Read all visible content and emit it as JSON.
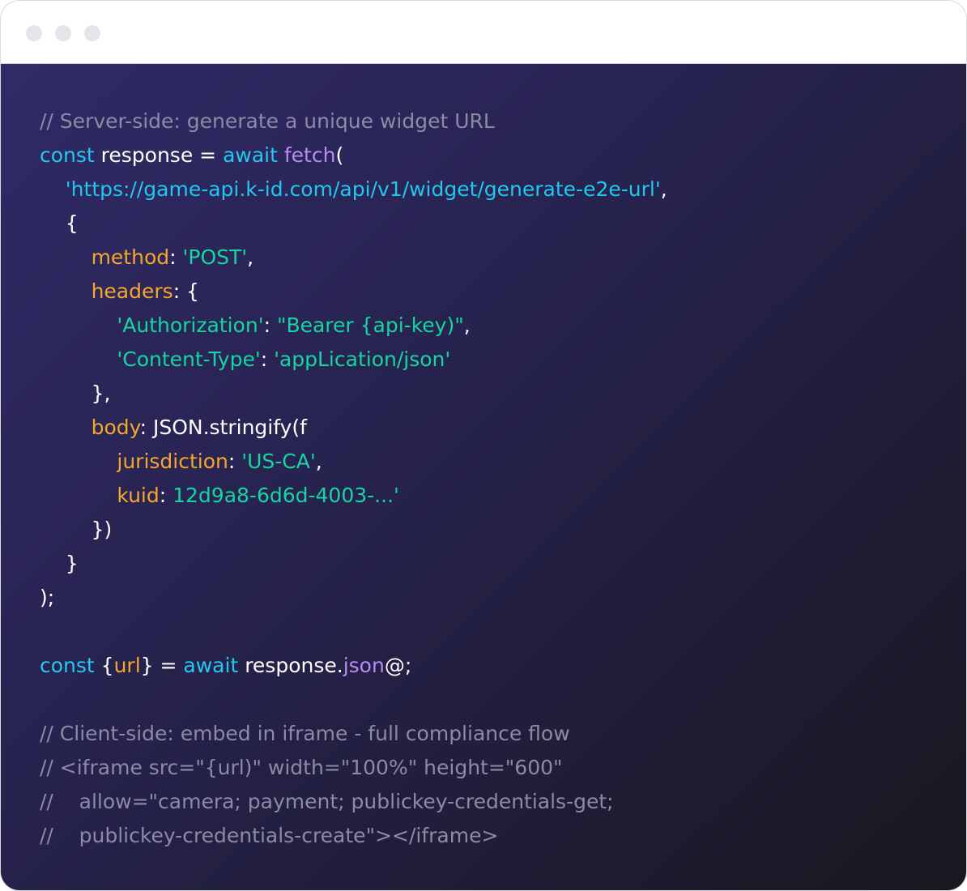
{
  "window": {
    "controls": [
      "close",
      "minimize",
      "maximize"
    ]
  },
  "code": {
    "lines": [
      [
        {
          "t": "// Server-side: generate a unique widget URL",
          "c": "cm"
        }
      ],
      [
        {
          "t": "const",
          "c": "kw"
        },
        {
          "t": " response = ",
          "c": "pl"
        },
        {
          "t": "await",
          "c": "kw"
        },
        {
          "t": " ",
          "c": "pl"
        },
        {
          "t": "fetch",
          "c": "fn"
        },
        {
          "t": "(",
          "c": "pl"
        }
      ],
      [
        {
          "t": "    ",
          "c": "pl"
        },
        {
          "t": "'https://game-api.k-id.com/api/v1/widget/generate-e2e-url'",
          "c": "url"
        },
        {
          "t": ",",
          "c": "pl"
        }
      ],
      [
        {
          "t": "    {",
          "c": "pl"
        }
      ],
      [
        {
          "t": "        ",
          "c": "pl"
        },
        {
          "t": "method",
          "c": "key"
        },
        {
          "t": ": ",
          "c": "pl"
        },
        {
          "t": "'POST'",
          "c": "str"
        },
        {
          "t": ",",
          "c": "pl"
        }
      ],
      [
        {
          "t": "        ",
          "c": "pl"
        },
        {
          "t": "headers",
          "c": "key"
        },
        {
          "t": ": {",
          "c": "pl"
        }
      ],
      [
        {
          "t": "            ",
          "c": "pl"
        },
        {
          "t": "'Authorization'",
          "c": "str"
        },
        {
          "t": ": ",
          "c": "pl"
        },
        {
          "t": "\"Bearer {api-key)\"",
          "c": "str"
        },
        {
          "t": ",",
          "c": "pl"
        }
      ],
      [
        {
          "t": "            ",
          "c": "pl"
        },
        {
          "t": "'Content-Type'",
          "c": "str"
        },
        {
          "t": ": ",
          "c": "pl"
        },
        {
          "t": "'appLication/json'",
          "c": "str"
        }
      ],
      [
        {
          "t": "        },",
          "c": "pl"
        }
      ],
      [
        {
          "t": "        ",
          "c": "pl"
        },
        {
          "t": "body",
          "c": "key"
        },
        {
          "t": ": JSON.stringify(f",
          "c": "pl"
        }
      ],
      [
        {
          "t": "            ",
          "c": "pl"
        },
        {
          "t": "jurisdiction",
          "c": "key"
        },
        {
          "t": ": ",
          "c": "pl"
        },
        {
          "t": "'US-CA'",
          "c": "str"
        },
        {
          "t": ",",
          "c": "pl"
        }
      ],
      [
        {
          "t": "            ",
          "c": "pl"
        },
        {
          "t": "kuid",
          "c": "key"
        },
        {
          "t": ": ",
          "c": "pl"
        },
        {
          "t": "12d9a8-6d6d-4003-...'",
          "c": "str"
        }
      ],
      [
        {
          "t": "        })",
          "c": "pl"
        }
      ],
      [
        {
          "t": "    }",
          "c": "pl"
        }
      ],
      [
        {
          "t": ");",
          "c": "pl"
        }
      ],
      [
        {
          "t": "",
          "c": "pl"
        }
      ],
      [
        {
          "t": "const",
          "c": "kw"
        },
        {
          "t": " {",
          "c": "pl"
        },
        {
          "t": "url",
          "c": "key"
        },
        {
          "t": "} = ",
          "c": "pl"
        },
        {
          "t": "await",
          "c": "kw"
        },
        {
          "t": " response.",
          "c": "pl"
        },
        {
          "t": "json",
          "c": "fn"
        },
        {
          "t": "@;",
          "c": "pl"
        }
      ],
      [
        {
          "t": "",
          "c": "pl"
        }
      ],
      [
        {
          "t": "// Client-side: embed in iframe - full compliance flow",
          "c": "cm"
        }
      ],
      [
        {
          "t": "// <iframe src=\"{url)\" width=\"100%\" height=\"600\"",
          "c": "cm"
        }
      ],
      [
        {
          "t": "//    allow=\"camera; payment; publickey-credentials-get;",
          "c": "cm"
        }
      ],
      [
        {
          "t": "//    publickey-credentials-create\"></iframe>",
          "c": "cm"
        }
      ]
    ]
  },
  "colors": {
    "comment": "#8d8aa6",
    "keyword": "#24c8f0",
    "function": "#b68cf2",
    "string": "#17d4a0",
    "property": "#f5a62b",
    "plain": "#ffffff"
  }
}
